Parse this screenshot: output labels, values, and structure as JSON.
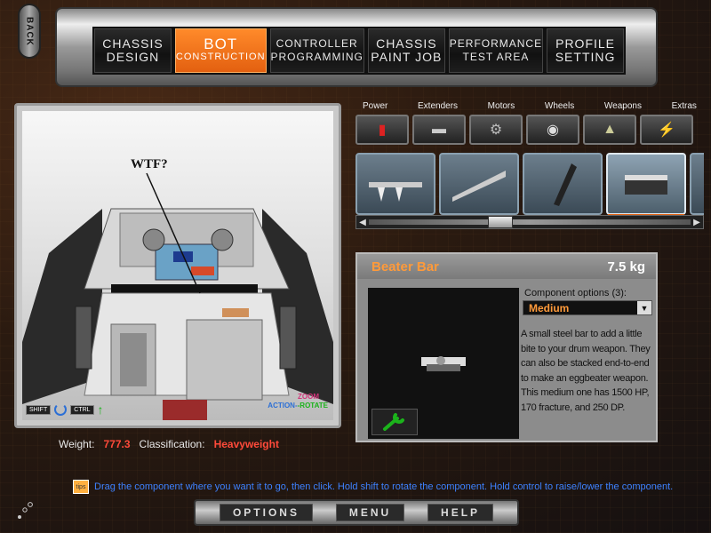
{
  "nav": {
    "back_label": "BACK",
    "tabs": [
      {
        "line1": "CHASSIS",
        "line2": "DESIGN"
      },
      {
        "line1": "BOT",
        "line2": "CONSTRUCTION"
      },
      {
        "line1": "CONTROLLER",
        "line2": "PROGRAMMING"
      },
      {
        "line1": "CHASSIS",
        "line2": "PAINT JOB"
      },
      {
        "line1": "PERFORMANCE",
        "line2": "TEST AREA"
      },
      {
        "line1": "PROFILE",
        "line2": "SETTING"
      }
    ]
  },
  "viewport": {
    "annotation": "WTF?",
    "controls": {
      "shift": "SHIFT",
      "ctrl": "CTRL",
      "zoom": "ZOOM",
      "action": "ACTION-",
      "rotate": "-ROTATE"
    }
  },
  "status": {
    "weight_label": "Weight:",
    "weight_value": "777.3",
    "class_label": "Classification:",
    "class_value": "Heavyweight"
  },
  "categories": [
    "Power",
    "Extenders",
    "Motors",
    "Wheels",
    "Weapons",
    "Extras"
  ],
  "component": {
    "name": "Beater Bar",
    "weight": "7.5 kg",
    "options_label": "Component options (3):",
    "selected_option": "Medium",
    "description": "A small steel bar to add a little bite to your drum weapon. They can also be stacked end-to-end to make an eggbeater weapon. This medium one has 1500 HP, 170 fracture, and 250 DP."
  },
  "tip": {
    "icon_label": "tips",
    "text": "Drag the component where you want it to go, then click. Hold shift to rotate the component. Hold control to raise/lower the component."
  },
  "bottom_menu": {
    "options": "OPTIONS",
    "menu": "MENU",
    "help": "HELP"
  },
  "colors": {
    "accent": "#e36010",
    "danger_text": "#ff4a3a",
    "tip_text": "#3e82ff",
    "title_orange": "#ff9a3a"
  }
}
